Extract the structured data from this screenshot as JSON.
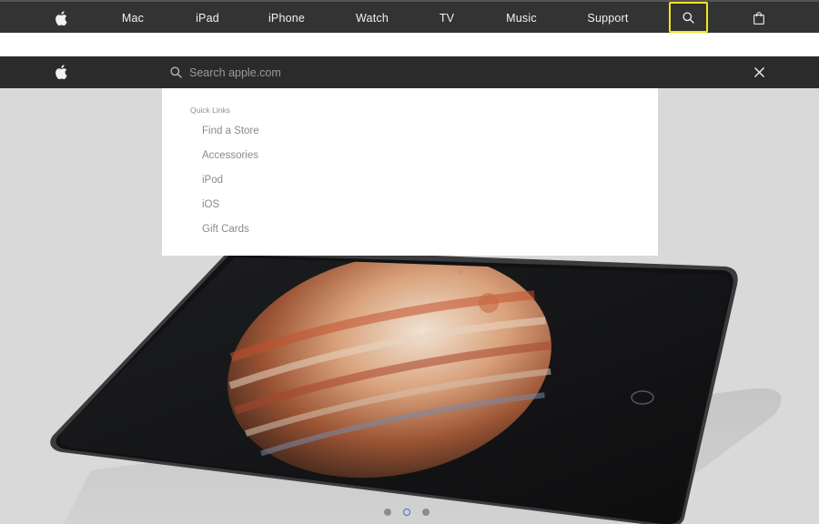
{
  "nav": {
    "apple_logo": "apple-icon",
    "items": [
      "Mac",
      "iPad",
      "iPhone",
      "Watch",
      "TV",
      "Music",
      "Support"
    ],
    "search_icon": "search-icon",
    "bag_icon": "bag-icon",
    "highlight_color": "#f3e51b"
  },
  "searchbar": {
    "apple_logo": "apple-icon",
    "search_icon": "search-icon",
    "placeholder": "Search apple.com",
    "close_icon": "close-icon"
  },
  "quick_links": {
    "header": "Quick Links",
    "items": [
      "Find a Store",
      "Accessories",
      "iPod",
      "iOS",
      "Gift Cards"
    ]
  },
  "carousel": {
    "dot_count": 3,
    "active_index": 1
  }
}
